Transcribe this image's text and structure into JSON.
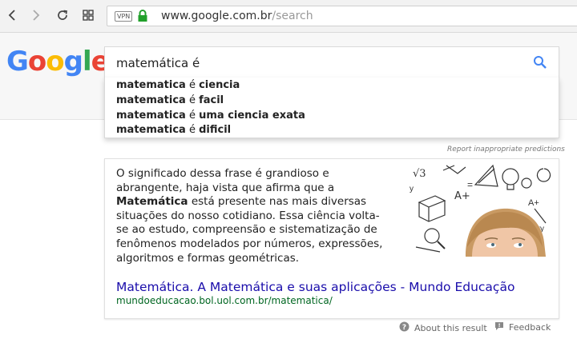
{
  "browser": {
    "vpn_label": "VPN",
    "url_host": "www.google.com.br",
    "url_path": "/search"
  },
  "logo": {
    "letters": [
      "G",
      "o",
      "o",
      "g",
      "l",
      "e"
    ],
    "colors": [
      "#4285F4",
      "#EA4335",
      "#FBBC05",
      "#4285F4",
      "#34A853",
      "#EA4335"
    ]
  },
  "search": {
    "query": "matemática é"
  },
  "suggestions": [
    {
      "prefix": "matematica",
      "mid": " é ",
      "suffix": "ciencia"
    },
    {
      "prefix": "matematica",
      "mid": " é ",
      "suffix": "facil"
    },
    {
      "prefix": "matematica",
      "mid": " é ",
      "suffix": "uma ciencia exata"
    },
    {
      "prefix": "matematica",
      "mid": " é ",
      "suffix": "dificil"
    }
  ],
  "report_text": "Report inappropriate predictions",
  "card": {
    "snippet_before": "O significado dessa frase é grandioso e abrangente, haja vista que afirma que a ",
    "snippet_bold": "Matemática",
    "snippet_after": " está presente nas mais diversas situações do nosso cotidiano. Essa ciência volta-se ao estudo, compreensão e sistematização de fenômenos modelados por números, expressões, algoritmos e formas geométricas.",
    "result_title": "Matemática. A Matemática e suas aplicações - Mundo Educação",
    "result_url": "mundoeducacao.bol.uol.com.br/matematica/"
  },
  "footer": {
    "about": "About this result",
    "feedback": "Feedback"
  },
  "colors": {
    "link": "#1a0dab",
    "url_green": "#006621",
    "lock_green": "#21a02b",
    "search_blue": "#4285F4"
  }
}
